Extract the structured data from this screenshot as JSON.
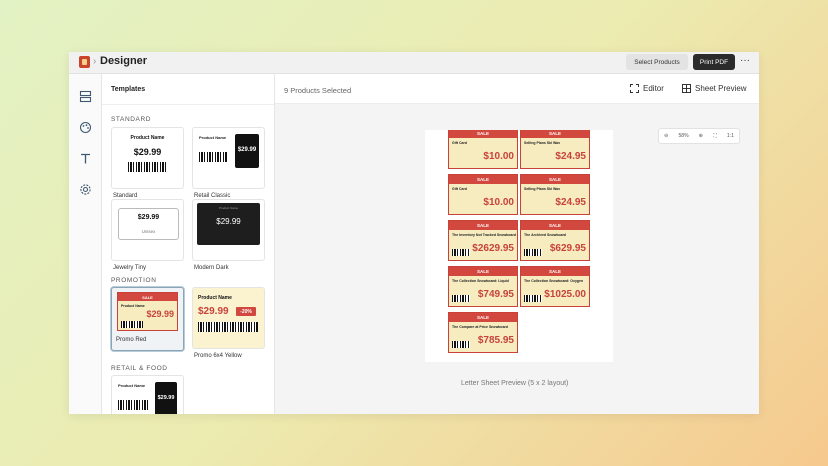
{
  "app": {
    "title": "Designer",
    "breadcrumb_sep": "›"
  },
  "toolbar": {
    "select_products": "Select Products",
    "print_pdf": "Print PDF",
    "more": "···"
  },
  "rail": {
    "icons": [
      "layout-icon",
      "palette-icon",
      "text-icon",
      "settings-icon"
    ]
  },
  "sidebar": {
    "title": "Templates",
    "sections": [
      {
        "name": "STANDARD",
        "templates": [
          {
            "label": "Standard",
            "preview_title": "Product Name",
            "preview_price": "$29.99"
          },
          {
            "label": "Retail Classic",
            "preview_title": "Product Name",
            "preview_price": "$29.99"
          }
        ]
      },
      {
        "name": "",
        "templates": [
          {
            "label": "Jewelry Tiny",
            "preview_price": "$29.99",
            "preview_sub": "Unisex"
          },
          {
            "label": "Modern Dark",
            "preview_title": "Product Name",
            "preview_price": "$29.99"
          }
        ]
      },
      {
        "name": "PROMOTION",
        "templates": [
          {
            "label": "Promo Red",
            "preview_band": "SALE",
            "preview_title": "Product Name",
            "preview_price": "$29.99",
            "selected": true
          },
          {
            "label": "Promo 6x4 Yellow",
            "preview_title": "Product Name",
            "preview_price": "$29.99",
            "preview_badge": "-20%"
          }
        ]
      },
      {
        "name": "RETAIL & FOOD",
        "templates": [
          {
            "label": "",
            "preview_title": "Product Name",
            "preview_price": "$29.99"
          }
        ]
      }
    ]
  },
  "main": {
    "selected_count": "9 Products Selected",
    "editor_label": "Editor",
    "sheet_preview_label": "Sheet Preview",
    "zoom": {
      "level": "58%"
    },
    "caption": "Letter Sheet Preview (5 x 2 layout)"
  },
  "sheet_labels": [
    {
      "band": "SALE",
      "name": "Gift Card",
      "price": "$10.00"
    },
    {
      "band": "SALE",
      "name": "Selling Plans Ski Wax",
      "price": "$24.95"
    },
    {
      "band": "SALE",
      "name": "Gift Card",
      "price": "$10.00"
    },
    {
      "band": "SALE",
      "name": "Selling Plans Ski Wax",
      "price": "$24.95"
    },
    {
      "band": "SALE",
      "name": "The Inventory Not Tracked Snowboard",
      "price": "$2629.95"
    },
    {
      "band": "SALE",
      "name": "The Archived Snowboard",
      "price": "$629.95"
    },
    {
      "band": "SALE",
      "name": "The Collection Snowboard: Liquid",
      "price": "$749.95"
    },
    {
      "band": "SALE",
      "name": "The Collection Snowboard: Oxygen",
      "price": "$1025.00"
    },
    {
      "band": "SALE",
      "name": "The Compare at Price Snowboard",
      "price": "$785.95"
    }
  ],
  "colors": {
    "sale_red": "#d2473e",
    "label_bg": "#f6ecc0",
    "dark_button": "#2b2b2b"
  }
}
